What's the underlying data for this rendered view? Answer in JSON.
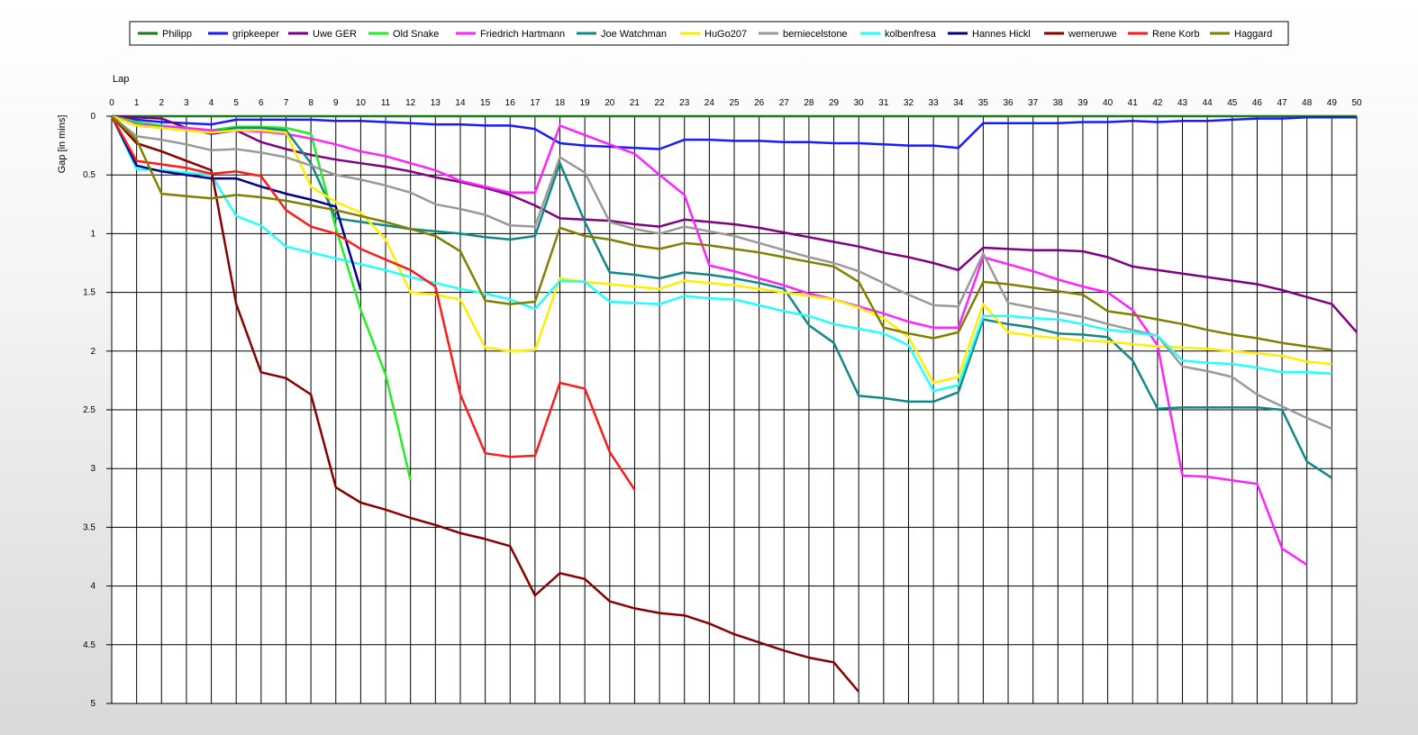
{
  "chart_data": {
    "type": "line",
    "xlabel": "Lap",
    "ylabel": "Gap [in mins]",
    "xlim": [
      0,
      50
    ],
    "ylim": [
      0,
      5
    ],
    "y_inverted": true,
    "grid": true,
    "legend_placement": "top",
    "x_ticks": [
      0,
      1,
      2,
      3,
      4,
      5,
      6,
      7,
      8,
      9,
      10,
      11,
      12,
      13,
      14,
      15,
      16,
      17,
      18,
      19,
      20,
      21,
      22,
      23,
      24,
      25,
      26,
      27,
      28,
      29,
      30,
      31,
      32,
      33,
      34,
      35,
      36,
      37,
      38,
      39,
      40,
      41,
      42,
      43,
      44,
      45,
      46,
      47,
      48,
      49,
      50
    ],
    "y_ticks": [
      "0",
      "0.5",
      "1",
      "1.5",
      "2",
      "2.5",
      "3",
      "3.5",
      "4",
      "4.5",
      "5"
    ],
    "series": [
      {
        "name": "Philipp",
        "color": "#1a7a1a",
        "x": [
          0,
          50
        ],
        "y": [
          0,
          0
        ]
      },
      {
        "name": "gripkeeper",
        "color": "#1a1aff",
        "x": [
          0,
          1,
          2,
          3,
          4,
          5,
          6,
          7,
          8,
          9,
          10,
          11,
          12,
          13,
          14,
          15,
          16,
          17,
          18,
          19,
          20,
          21,
          22,
          23,
          24,
          25,
          26,
          27,
          28,
          29,
          30,
          31,
          32,
          33,
          34,
          35,
          36,
          37,
          38,
          39,
          40,
          41,
          42,
          43,
          44,
          45,
          46,
          47,
          48,
          49,
          50
        ],
        "y": [
          0,
          0.03,
          0.05,
          0.06,
          0.07,
          0.03,
          0.03,
          0.03,
          0.03,
          0.04,
          0.04,
          0.05,
          0.06,
          0.07,
          0.07,
          0.08,
          0.08,
          0.11,
          0.23,
          0.25,
          0.26,
          0.27,
          0.28,
          0.2,
          0.2,
          0.21,
          0.21,
          0.22,
          0.22,
          0.23,
          0.23,
          0.24,
          0.25,
          0.25,
          0.27,
          0.06,
          0.06,
          0.06,
          0.06,
          0.05,
          0.05,
          0.04,
          0.05,
          0.04,
          0.04,
          0.03,
          0.02,
          0.02,
          0.01,
          0.01,
          0.01
        ]
      },
      {
        "name": "Uwe GER",
        "color": "#800080",
        "x": [
          0,
          1,
          2,
          3,
          4,
          5,
          6,
          7,
          8,
          9,
          10,
          11,
          12,
          13,
          14,
          15,
          16,
          17,
          18,
          19,
          20,
          21,
          22,
          23,
          24,
          25,
          26,
          27,
          28,
          29,
          30,
          31,
          32,
          33,
          34,
          35,
          36,
          37,
          38,
          39,
          40,
          41,
          42,
          43,
          44,
          45,
          46,
          47,
          48,
          49,
          50
        ],
        "y": [
          0,
          0.01,
          0.02,
          0.1,
          0.15,
          0.12,
          0.22,
          0.28,
          0.33,
          0.37,
          0.4,
          0.43,
          0.47,
          0.52,
          0.56,
          0.61,
          0.67,
          0.76,
          0.87,
          0.88,
          0.89,
          0.92,
          0.94,
          0.88,
          0.9,
          0.92,
          0.95,
          0.99,
          1.03,
          1.07,
          1.11,
          1.16,
          1.2,
          1.25,
          1.31,
          1.12,
          1.13,
          1.14,
          1.14,
          1.15,
          1.2,
          1.28,
          1.31,
          1.34,
          1.37,
          1.4,
          1.43,
          1.48,
          1.54,
          1.6,
          1.84
        ]
      },
      {
        "name": "Old Snake",
        "color": "#22ee22",
        "x": [
          0,
          1,
          2,
          3,
          4,
          5,
          6,
          7,
          8,
          9,
          10,
          11,
          12
        ],
        "y": [
          0,
          0.05,
          0.08,
          0.1,
          0.12,
          0.09,
          0.09,
          0.1,
          0.15,
          0.95,
          1.65,
          2.2,
          3.1
        ]
      },
      {
        "name": "Friedrich Hartmann",
        "color": "#ff22ff",
        "x": [
          0,
          1,
          2,
          3,
          4,
          5,
          6,
          7,
          8,
          9,
          10,
          11,
          12,
          13,
          14,
          15,
          16,
          17,
          18,
          19,
          20,
          21,
          22,
          23,
          24,
          25,
          26,
          27,
          28,
          29,
          30,
          31,
          32,
          33,
          34,
          35,
          36,
          37,
          38,
          39,
          40,
          41,
          42,
          43,
          44,
          45,
          46,
          47,
          48
        ],
        "y": [
          0,
          0.07,
          0.09,
          0.1,
          0.12,
          0.12,
          0.13,
          0.15,
          0.19,
          0.24,
          0.3,
          0.34,
          0.4,
          0.46,
          0.55,
          0.6,
          0.65,
          0.65,
          0.08,
          0.16,
          0.24,
          0.32,
          0.5,
          0.67,
          1.27,
          1.32,
          1.38,
          1.44,
          1.51,
          1.56,
          1.62,
          1.68,
          1.75,
          1.8,
          1.8,
          1.2,
          1.26,
          1.32,
          1.39,
          1.45,
          1.5,
          1.65,
          1.95,
          3.06,
          3.07,
          3.1,
          3.13,
          3.68,
          3.82
        ]
      },
      {
        "name": "Joe Watchman",
        "color": "#118888",
        "x": [
          0,
          1,
          2,
          3,
          4,
          5,
          6,
          7,
          8,
          9,
          10,
          11,
          12,
          13,
          14,
          15,
          16,
          17,
          18,
          19,
          20,
          21,
          22,
          23,
          24,
          25,
          26,
          27,
          28,
          29,
          30,
          31,
          32,
          33,
          34,
          35,
          36,
          37,
          38,
          39,
          40,
          41,
          42,
          43,
          44,
          45,
          46,
          47,
          48,
          49
        ],
        "y": [
          0,
          0.08,
          0.1,
          0.12,
          0.14,
          0.1,
          0.1,
          0.12,
          0.4,
          0.87,
          0.9,
          0.93,
          0.96,
          0.98,
          1,
          1.03,
          1.05,
          1.02,
          0.4,
          0.9,
          1.33,
          1.35,
          1.38,
          1.33,
          1.35,
          1.38,
          1.42,
          1.47,
          1.78,
          1.93,
          2.38,
          2.4,
          2.43,
          2.43,
          2.35,
          1.73,
          1.77,
          1.8,
          1.85,
          1.86,
          1.88,
          2.08,
          2.49,
          2.48,
          2.48,
          2.48,
          2.48,
          2.5,
          2.94,
          3.08
        ]
      },
      {
        "name": "HuGo207",
        "color": "#ffee00",
        "x": [
          0,
          1,
          2,
          3,
          4,
          5,
          6,
          7,
          8,
          9,
          10,
          11,
          12,
          13,
          14,
          15,
          16,
          17,
          18,
          19,
          20,
          21,
          22,
          23,
          24,
          25,
          26,
          27,
          28,
          29,
          30,
          31,
          32,
          33,
          34,
          35,
          36,
          37,
          38,
          39,
          40,
          41,
          42,
          43,
          44,
          45,
          46,
          47,
          48,
          49
        ],
        "y": [
          0,
          0.08,
          0.1,
          0.12,
          0.14,
          0.12,
          0.12,
          0.14,
          0.6,
          0.73,
          0.82,
          1.05,
          1.5,
          1.52,
          1.56,
          1.97,
          2,
          1.99,
          1.38,
          1.41,
          1.43,
          1.45,
          1.47,
          1.4,
          1.42,
          1.44,
          1.47,
          1.5,
          1.53,
          1.56,
          1.63,
          1.72,
          1.88,
          2.27,
          2.22,
          1.6,
          1.84,
          1.87,
          1.89,
          1.91,
          1.92,
          1.94,
          1.96,
          1.97,
          1.98,
          2,
          2.02,
          2.04,
          2.09,
          2.11
        ]
      },
      {
        "name": "berniecelstone",
        "color": "#999999",
        "x": [
          0,
          1,
          2,
          3,
          4,
          5,
          6,
          7,
          8,
          9,
          10,
          11,
          12,
          13,
          14,
          15,
          16,
          17,
          18,
          19,
          20,
          21,
          22,
          23,
          24,
          25,
          26,
          27,
          28,
          29,
          30,
          31,
          32,
          33,
          34,
          35,
          36,
          37,
          38,
          39,
          40,
          41,
          42,
          43,
          44,
          45,
          46,
          47,
          48,
          49
        ],
        "y": [
          0,
          0.17,
          0.2,
          0.24,
          0.29,
          0.28,
          0.31,
          0.35,
          0.42,
          0.5,
          0.54,
          0.59,
          0.65,
          0.75,
          0.79,
          0.84,
          0.93,
          0.94,
          0.35,
          0.48,
          0.9,
          0.96,
          1,
          0.94,
          0.98,
          1.02,
          1.08,
          1.14,
          1.2,
          1.25,
          1.32,
          1.42,
          1.52,
          1.61,
          1.62,
          1.17,
          1.59,
          1.63,
          1.67,
          1.71,
          1.77,
          1.82,
          1.87,
          2.13,
          2.17,
          2.22,
          2.37,
          2.47,
          2.57,
          2.66
        ]
      },
      {
        "name": "kolbenfresa",
        "color": "#22ffff",
        "x": [
          0,
          1,
          2,
          3,
          4,
          5,
          6,
          7,
          8,
          9,
          10,
          11,
          12,
          13,
          14,
          15,
          16,
          17,
          18,
          19,
          20,
          21,
          22,
          23,
          24,
          25,
          26,
          27,
          28,
          29,
          30,
          31,
          32,
          33,
          34,
          35,
          36,
          37,
          38,
          39,
          40,
          41,
          42,
          43,
          44,
          45,
          46,
          47,
          48,
          49
        ],
        "y": [
          0,
          0.45,
          0.46,
          0.48,
          0.5,
          0.85,
          0.93,
          1.11,
          1.16,
          1.21,
          1.26,
          1.31,
          1.37,
          1.42,
          1.47,
          1.51,
          1.56,
          1.64,
          1.4,
          1.41,
          1.58,
          1.59,
          1.6,
          1.53,
          1.55,
          1.56,
          1.61,
          1.66,
          1.7,
          1.77,
          1.81,
          1.85,
          1.95,
          2.34,
          2.29,
          1.7,
          1.7,
          1.72,
          1.73,
          1.77,
          1.82,
          1.84,
          1.87,
          2.08,
          2.1,
          2.11,
          2.14,
          2.18,
          2.18,
          2.19
        ]
      },
      {
        "name": "Hannes Hickl",
        "color": "#000088",
        "x": [
          0,
          1,
          2,
          3,
          4,
          5,
          6,
          7,
          8,
          9,
          10
        ],
        "y": [
          0,
          0.42,
          0.47,
          0.5,
          0.53,
          0.53,
          0.6,
          0.66,
          0.71,
          0.77,
          1.48
        ]
      },
      {
        "name": "werneruwe",
        "color": "#880000",
        "x": [
          0,
          1,
          2,
          3,
          4,
          5,
          6,
          7,
          8,
          9,
          10,
          11,
          12,
          13,
          14,
          15,
          16,
          17,
          18,
          19,
          20,
          21,
          22,
          23,
          24,
          25,
          26,
          27,
          28,
          29,
          30
        ],
        "y": [
          0,
          0.23,
          0.3,
          0.38,
          0.46,
          1.6,
          2.18,
          2.23,
          2.37,
          3.16,
          3.29,
          3.35,
          3.42,
          3.48,
          3.55,
          3.6,
          3.66,
          4.08,
          3.89,
          3.94,
          4.13,
          4.19,
          4.23,
          4.25,
          4.32,
          4.41,
          4.48,
          4.55,
          4.61,
          4.65,
          4.9
        ]
      },
      {
        "name": "Rene Korb",
        "color": "#ff1a1a",
        "x": [
          0,
          1,
          2,
          3,
          4,
          5,
          6,
          7,
          8,
          9,
          10,
          11,
          12,
          13,
          14,
          15,
          16,
          17,
          18,
          19,
          20,
          21
        ],
        "y": [
          0,
          0.38,
          0.41,
          0.44,
          0.49,
          0.47,
          0.51,
          0.8,
          0.94,
          1,
          1.13,
          1.22,
          1.31,
          1.45,
          2.37,
          2.87,
          2.9,
          2.89,
          2.27,
          2.32,
          2.86,
          3.18
        ]
      },
      {
        "name": "Haggard",
        "color": "#808000",
        "x": [
          0,
          1,
          2,
          3,
          4,
          5,
          6,
          7,
          8,
          9,
          10,
          11,
          12,
          13,
          14,
          15,
          16,
          17,
          18,
          19,
          20,
          21,
          22,
          23,
          24,
          25,
          26,
          27,
          28,
          29,
          30,
          31,
          32,
          33,
          34,
          35,
          36,
          37,
          38,
          39,
          40,
          41,
          42,
          43,
          44,
          45,
          46,
          47,
          48,
          49
        ],
        "y": [
          0,
          0.2,
          0.66,
          0.68,
          0.7,
          0.67,
          0.69,
          0.72,
          0.76,
          0.8,
          0.85,
          0.9,
          0.96,
          1.02,
          1.15,
          1.57,
          1.6,
          1.58,
          0.95,
          1.02,
          1.05,
          1.1,
          1.13,
          1.08,
          1.1,
          1.13,
          1.16,
          1.2,
          1.24,
          1.28,
          1.41,
          1.8,
          1.85,
          1.89,
          1.84,
          1.41,
          1.43,
          1.46,
          1.49,
          1.52,
          1.66,
          1.69,
          1.73,
          1.77,
          1.82,
          1.86,
          1.89,
          1.93,
          1.96,
          1.99
        ]
      }
    ]
  }
}
